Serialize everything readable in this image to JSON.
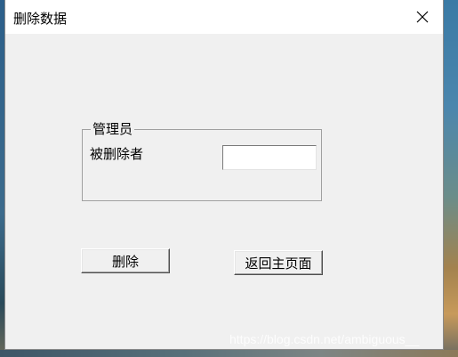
{
  "window": {
    "title": "删除数据"
  },
  "group": {
    "legend": "管理员",
    "field_label": "被删除者",
    "field_value": ""
  },
  "buttons": {
    "delete_label": "删除",
    "back_label": "返回主页面"
  },
  "watermark": "https://blog.csdn.net/ambiguous__"
}
